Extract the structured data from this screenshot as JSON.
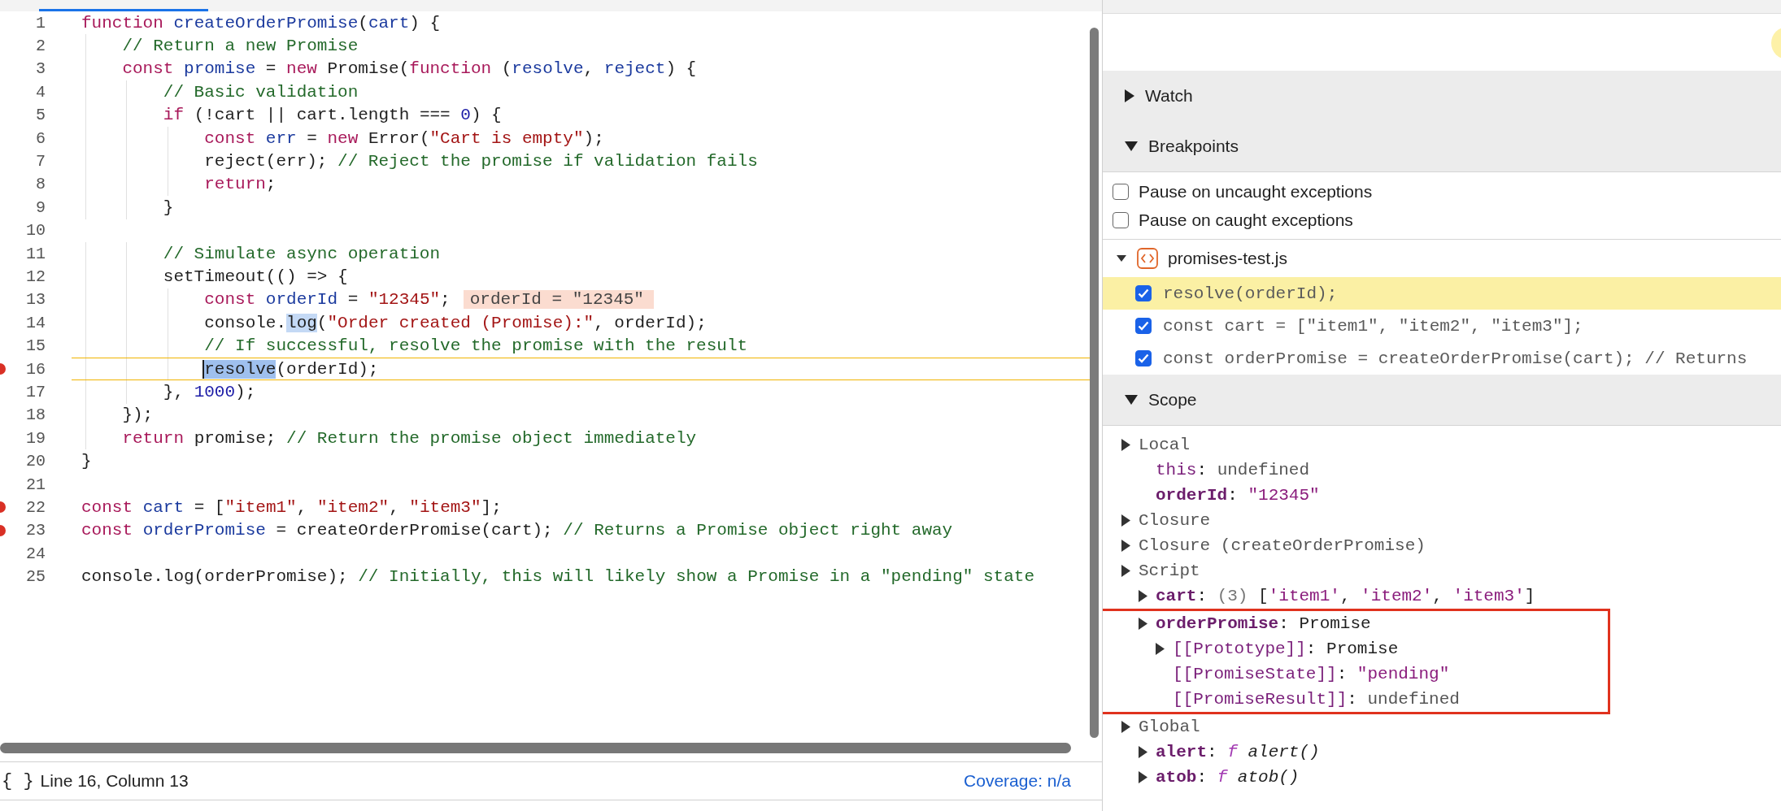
{
  "editor": {
    "lines": [
      {
        "number": "1",
        "tokens": [
          {
            "text": "function ",
            "kind": "kw"
          },
          {
            "text": "createOrderPromise",
            "kind": "def"
          },
          {
            "text": "(",
            "kind": "plain"
          },
          {
            "text": "cart",
            "kind": "def"
          },
          {
            "text": ") {",
            "kind": "plain"
          }
        ]
      },
      {
        "number": "2",
        "tokens": [
          {
            "text": "    // Return a new Promise",
            "kind": "com"
          }
        ]
      },
      {
        "number": "3",
        "tokens": [
          {
            "text": "    const ",
            "kind": "kw"
          },
          {
            "text": "promise",
            "kind": "def"
          },
          {
            "text": " = ",
            "kind": "plain"
          },
          {
            "text": "new",
            "kind": "kw"
          },
          {
            "text": " Promise(",
            "kind": "plain"
          },
          {
            "text": "function",
            "kind": "kw"
          },
          {
            "text": " (",
            "kind": "plain"
          },
          {
            "text": "resolve",
            "kind": "def"
          },
          {
            "text": ", ",
            "kind": "plain"
          },
          {
            "text": "reject",
            "kind": "def"
          },
          {
            "text": ") {",
            "kind": "plain"
          }
        ]
      },
      {
        "number": "4",
        "tokens": [
          {
            "text": "        // Basic validation",
            "kind": "com"
          }
        ]
      },
      {
        "number": "5",
        "tokens": [
          {
            "text": "        if",
            "kind": "kw"
          },
          {
            "text": " (!cart || cart.length === ",
            "kind": "plain"
          },
          {
            "text": "0",
            "kind": "num"
          },
          {
            "text": ") {",
            "kind": "plain"
          }
        ]
      },
      {
        "number": "6",
        "tokens": [
          {
            "text": "            const ",
            "kind": "kw"
          },
          {
            "text": "err",
            "kind": "def"
          },
          {
            "text": " = ",
            "kind": "plain"
          },
          {
            "text": "new",
            "kind": "kw"
          },
          {
            "text": " Error(",
            "kind": "plain"
          },
          {
            "text": "\"Cart is empty\"",
            "kind": "str"
          },
          {
            "text": ");",
            "kind": "plain"
          }
        ]
      },
      {
        "number": "7",
        "tokens": [
          {
            "text": "            reject(err); ",
            "kind": "plain"
          },
          {
            "text": "// Reject the promise if validation fails",
            "kind": "com"
          }
        ]
      },
      {
        "number": "8",
        "tokens": [
          {
            "text": "            return",
            "kind": "kw"
          },
          {
            "text": ";",
            "kind": "plain"
          }
        ]
      },
      {
        "number": "9",
        "tokens": [
          {
            "text": "        }",
            "kind": "plain"
          }
        ]
      },
      {
        "number": "10"
      },
      {
        "number": "11",
        "tokens": [
          {
            "text": "        // Simulate async operation",
            "kind": "com"
          }
        ]
      },
      {
        "number": "12",
        "tokens": [
          {
            "text": "        setTimeout(() => {",
            "kind": "plain"
          }
        ]
      },
      {
        "number": "13",
        "tokens": [
          {
            "text": "            const ",
            "kind": "kw"
          },
          {
            "text": "orderId",
            "kind": "def"
          },
          {
            "text": " = ",
            "kind": "plain"
          },
          {
            "text": "\"12345\"",
            "kind": "str"
          },
          {
            "text": ";",
            "kind": "plain"
          }
        ],
        "inline_value": "orderId = \"12345\""
      },
      {
        "number": "14",
        "tokens": [
          {
            "text": "            console.",
            "kind": "plain"
          },
          {
            "text": "log",
            "kind": "plain",
            "highlighted": true
          },
          {
            "text": "(",
            "kind": "plain"
          },
          {
            "text": "\"Order created (Promise):\"",
            "kind": "str"
          },
          {
            "text": ", orderId);",
            "kind": "plain"
          }
        ]
      },
      {
        "number": "15",
        "tokens": [
          {
            "text": "            // If successful, resolve the promise with the result",
            "kind": "com"
          }
        ]
      },
      {
        "number": "16",
        "breakpoint": true,
        "current": true,
        "tokens": [
          {
            "text": "            resolve",
            "kind": "plain",
            "highlighted": true
          },
          {
            "text": "(orderId);",
            "kind": "plain"
          }
        ]
      },
      {
        "number": "17",
        "tokens": [
          {
            "text": "        }, ",
            "kind": "plain"
          },
          {
            "text": "1000",
            "kind": "num"
          },
          {
            "text": ");",
            "kind": "plain"
          }
        ]
      },
      {
        "number": "18",
        "tokens": [
          {
            "text": "    });",
            "kind": "plain"
          }
        ]
      },
      {
        "number": "19",
        "tokens": [
          {
            "text": "    return",
            "kind": "kw"
          },
          {
            "text": " promise; ",
            "kind": "plain"
          },
          {
            "text": "// Return the promise object immediately",
            "kind": "com"
          }
        ]
      },
      {
        "number": "20",
        "tokens": [
          {
            "text": "}",
            "kind": "plain"
          }
        ]
      },
      {
        "number": "21"
      },
      {
        "number": "22",
        "breakpoint": true,
        "tokens": [
          {
            "text": "const ",
            "kind": "kw"
          },
          {
            "text": "cart",
            "kind": "def"
          },
          {
            "text": " = [",
            "kind": "plain"
          },
          {
            "text": "\"item1\"",
            "kind": "str"
          },
          {
            "text": ", ",
            "kind": "plain"
          },
          {
            "text": "\"item2\"",
            "kind": "str"
          },
          {
            "text": ", ",
            "kind": "plain"
          },
          {
            "text": "\"item3\"",
            "kind": "str"
          },
          {
            "text": "];",
            "kind": "plain"
          }
        ]
      },
      {
        "number": "23",
        "breakpoint": true,
        "tokens": [
          {
            "text": "const ",
            "kind": "kw"
          },
          {
            "text": "orderPromise",
            "kind": "def"
          },
          {
            "text": " = createOrderPromise(cart); ",
            "kind": "plain"
          },
          {
            "text": "// Returns a Promise object right away",
            "kind": "com"
          }
        ]
      },
      {
        "number": "24"
      },
      {
        "number": "25",
        "tokens": [
          {
            "text": "console.log(orderPromise); ",
            "kind": "plain"
          },
          {
            "text": "// Initially, this will likely show a Promise in a \"pending\" state",
            "kind": "com"
          }
        ]
      }
    ]
  },
  "status_bar": {
    "pretty_print": "{ }",
    "position": "Line 16, Column 13",
    "coverage": "Coverage: n/a"
  },
  "sidebar": {
    "sections": [
      {
        "title": "Watch",
        "expanded": false
      },
      {
        "title": "Breakpoints",
        "expanded": true,
        "options": [
          {
            "label": "Pause on uncaught exceptions",
            "checked": false
          },
          {
            "label": "Pause on caught exceptions",
            "checked": false
          }
        ],
        "files": [
          {
            "name": "promises-test.js",
            "expanded": true,
            "breakpoints": [
              {
                "code": "resolve(orderId);",
                "checked": true,
                "active": true
              },
              {
                "code": "const cart = [\"item1\", \"item2\", \"item3\"];",
                "checked": true,
                "active": false
              },
              {
                "code": "const orderPromise = createOrderPromise(cart); // Returns",
                "checked": true,
                "active": false
              }
            ]
          }
        ]
      },
      {
        "title": "Scope",
        "expanded": true,
        "tree": [
          {
            "name": "Local",
            "kind": "scope",
            "toggle": true,
            "children": [
              {
                "name": "this",
                "kind": "property",
                "value": [
                  {
                    "text": ": ",
                    "kind": "plain"
                  },
                  {
                    "text": "undefined",
                    "kind": "undefined"
                  }
                ]
              },
              {
                "name": "orderId",
                "kind": "property",
                "bold": true,
                "value": [
                  {
                    "text": ": ",
                    "kind": "plain"
                  },
                  {
                    "text": "\"12345\"",
                    "kind": "string"
                  }
                ]
              }
            ]
          },
          {
            "name": "Closure",
            "kind": "scope",
            "toggle": true
          },
          {
            "name": "Closure (createOrderPromise)",
            "kind": "scope",
            "toggle": true
          },
          {
            "name": "Script",
            "kind": "scope",
            "toggle": true,
            "children": [
              {
                "name": "cart",
                "kind": "property",
                "bold": true,
                "toggle": true,
                "value": [
                  {
                    "text": ": ",
                    "kind": "plain"
                  },
                  {
                    "text": "(3) ",
                    "kind": "count"
                  },
                  {
                    "text": "[",
                    "kind": "plain"
                  },
                  {
                    "text": "'item1'",
                    "kind": "string"
                  },
                  {
                    "text": ", ",
                    "kind": "plain"
                  },
                  {
                    "text": "'item2'",
                    "kind": "string"
                  },
                  {
                    "text": ", ",
                    "kind": "plain"
                  },
                  {
                    "text": "'item3'",
                    "kind": "string"
                  },
                  {
                    "text": "]",
                    "kind": "plain"
                  }
                ]
              },
              {
                "name": "orderPromise",
                "kind": "property",
                "bold": true,
                "toggle": true,
                "outlined": true,
                "value": [
                  {
                    "text": ": Promise",
                    "kind": "plain"
                  }
                ],
                "children": [
                  {
                    "name": "[[Prototype]]",
                    "kind": "property",
                    "toggle": true,
                    "value": [
                      {
                        "text": ": Promise",
                        "kind": "plain"
                      }
                    ]
                  },
                  {
                    "name": "[[PromiseState]]",
                    "kind": "property",
                    "value": [
                      {
                        "text": ": ",
                        "kind": "plain"
                      },
                      {
                        "text": "\"pending\"",
                        "kind": "string"
                      }
                    ]
                  },
                  {
                    "name": "[[PromiseResult]]",
                    "kind": "property",
                    "value": [
                      {
                        "text": ": ",
                        "kind": "plain"
                      },
                      {
                        "text": "undefined",
                        "kind": "undefined"
                      }
                    ]
                  }
                ]
              }
            ]
          },
          {
            "name": "Global",
            "kind": "scope",
            "toggle": true,
            "children": [
              {
                "name": "alert",
                "kind": "property",
                "bold": true,
                "toggle": true,
                "value": [
                  {
                    "text": ": ",
                    "kind": "plain"
                  },
                  {
                    "text": "f ",
                    "kind": "function-sign"
                  },
                  {
                    "text": "alert()",
                    "kind": "function"
                  }
                ]
              },
              {
                "name": "atob",
                "kind": "property",
                "bold": true,
                "toggle": true,
                "value": [
                  {
                    "text": ": ",
                    "kind": "plain"
                  },
                  {
                    "text": "f ",
                    "kind": "function-sign"
                  },
                  {
                    "text": "atob()",
                    "kind": "function"
                  }
                ]
              }
            ]
          }
        ]
      }
    ]
  }
}
